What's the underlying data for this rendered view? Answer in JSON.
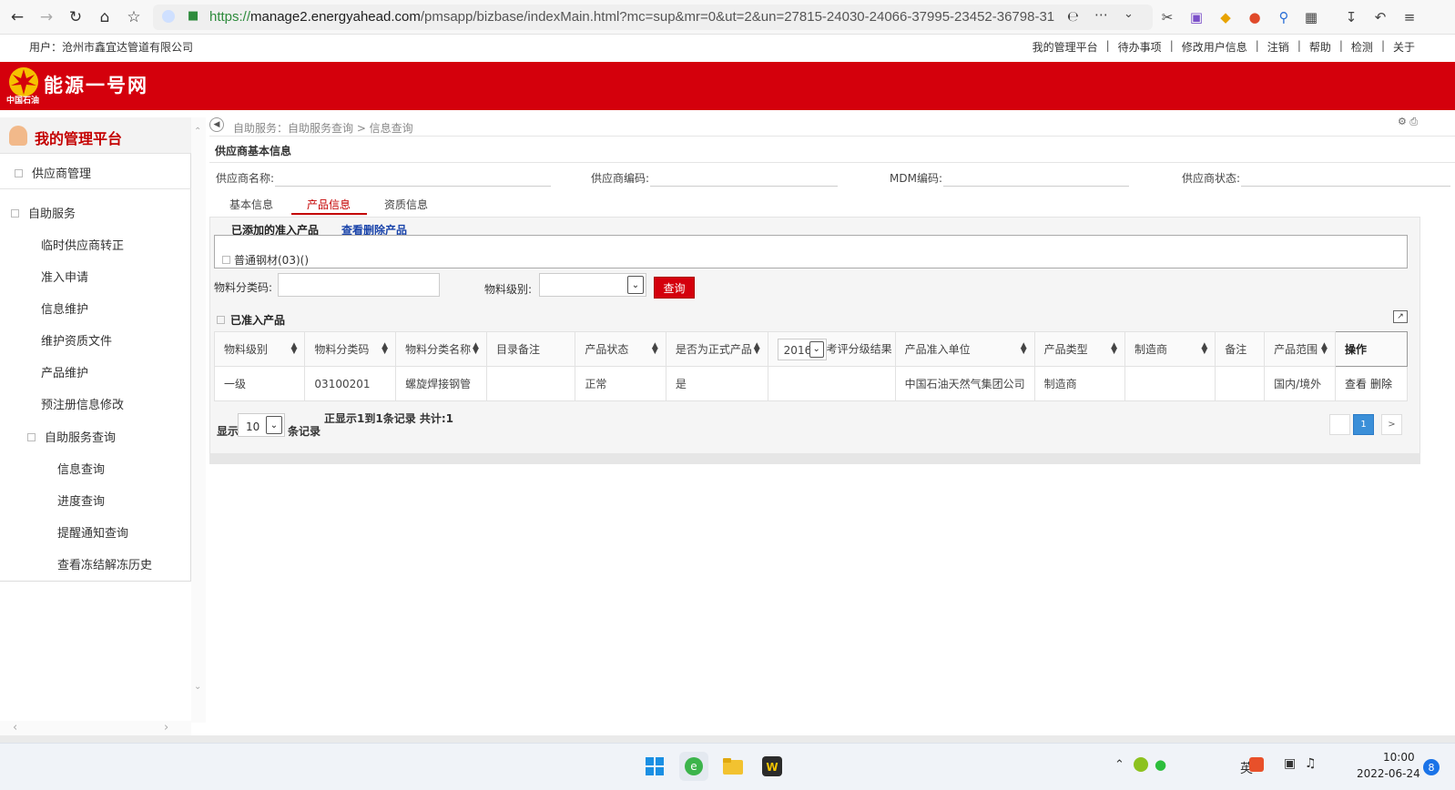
{
  "browser": {
    "url_protocol": "https://",
    "url_host": "manage2.energyahead.com",
    "url_path": "/pmsapp/bizbase/indexMain.html?mc=sup&mr=0&ut=2&un=27815-24030-24066-37995-23452-36798-31"
  },
  "userbar": {
    "user": "用户：沧州市鑫宜达管道有限公司",
    "links": [
      "我的管理平台",
      "待办事项",
      "修改用户信息",
      "注销",
      "帮助",
      "检测",
      "关于"
    ]
  },
  "banner": {
    "site_name": "能源一号网",
    "logo_sub": "中国石油"
  },
  "sidebar": {
    "title": "我的管理平台",
    "items": [
      "供应商管理",
      "自助服务",
      "临时供应商转正",
      "准入申请",
      "信息维护",
      "维护资质文件",
      "产品维护",
      "预注册信息修改",
      "自助服务查询",
      "信息查询",
      "进度查询",
      "提醒通知查询",
      "查看冻结解冻历史"
    ]
  },
  "main": {
    "breadcrumb": "自助服务：自助服务查询 > 信息查询",
    "section_title": "供应商基本信息",
    "fields": [
      "供应商名称:",
      "供应商编码:",
      "MDM编码:",
      "供应商状态:"
    ],
    "tabs": [
      "基本信息",
      "产品信息",
      "资质信息"
    ],
    "added_products": "已添加的准入产品",
    "view_deleted": "查看删除产品",
    "category": "普通钢材(03)()",
    "filter": {
      "code_label": "物料分类码:",
      "code_value": "",
      "level_label": "物料级别:",
      "level_value": "",
      "query_button": "查询"
    },
    "approved_title": "已准入产品",
    "table": {
      "headers": [
        "物料级别",
        "物料分类码",
        "物料分类名称",
        "目录备注",
        "产品状态",
        "是否为正式产品",
        "考评分级结果",
        "产品准入单位",
        "产品类型",
        "制造商",
        "备注",
        "产品范围",
        "操作"
      ],
      "year": "2016",
      "rows": [
        [
          "一级",
          "03100201",
          "螺旋焊接钢管",
          "",
          "正常",
          "是",
          "",
          "中国石油天然气集团公司",
          "制造商",
          "",
          "",
          "国内/境外",
          ""
        ]
      ],
      "ops": [
        "查看",
        "删除"
      ]
    },
    "pager": {
      "show": "显示",
      "page_size": "10",
      "records": "条记录",
      "info": "正显示1到1条记录 共计:1",
      "current": "1",
      "next": ">"
    }
  },
  "taskbar": {
    "lang": "英",
    "time": "10:00",
    "date": "2022-06-24",
    "notifications": "8"
  },
  "colors": {
    "brand_red": "#d4000c",
    "link_blue": "#1a44aa",
    "pager_blue": "#3b8fd8"
  }
}
